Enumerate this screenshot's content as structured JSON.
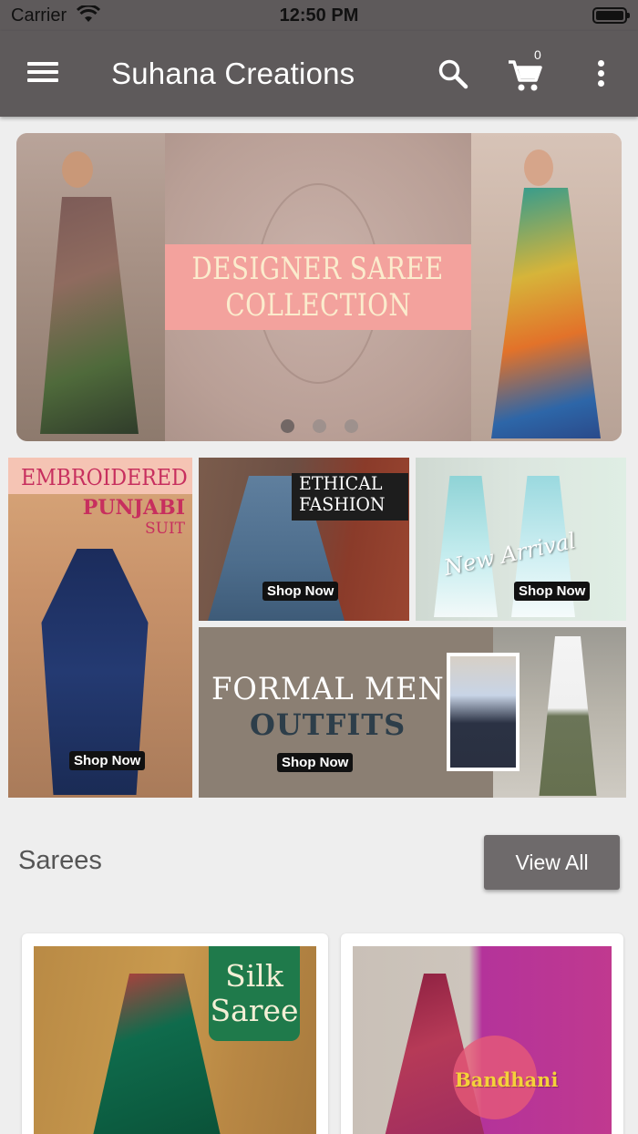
{
  "status_bar": {
    "carrier": "Carrier",
    "time": "12:50 PM"
  },
  "app_bar": {
    "title": "Suhana Creations",
    "cart_count": "0"
  },
  "banner": {
    "line1": "DESIGNER SAREE",
    "line2": "COLLECTION",
    "dots_total": 3,
    "active_dot": 1
  },
  "promos": {
    "punjabi": {
      "line1": "EMBROIDERED",
      "line2": "PUNJABI",
      "line3": "SUIT",
      "cta": "Shop Now"
    },
    "ethical": {
      "line1": "ETHICAL",
      "line2": "FASHION",
      "cta": "Shop Now"
    },
    "arrival": {
      "text": "New Arrival",
      "cta": "Shop Now"
    },
    "formal": {
      "line1": "FORMAL MEN",
      "line2": "OUTFITS",
      "cta": "Shop Now"
    }
  },
  "section": {
    "title": "Sarees",
    "view_all": "View All"
  },
  "products": [
    {
      "label_line1": "Silk",
      "label_line2": "Saree"
    },
    {
      "label": "Bandhani"
    }
  ],
  "colors": {
    "app_bar": "#5e5a5b",
    "background": "#eeeeee",
    "button": "#6e6a6b",
    "banner_title_box": "#f3a29d"
  }
}
